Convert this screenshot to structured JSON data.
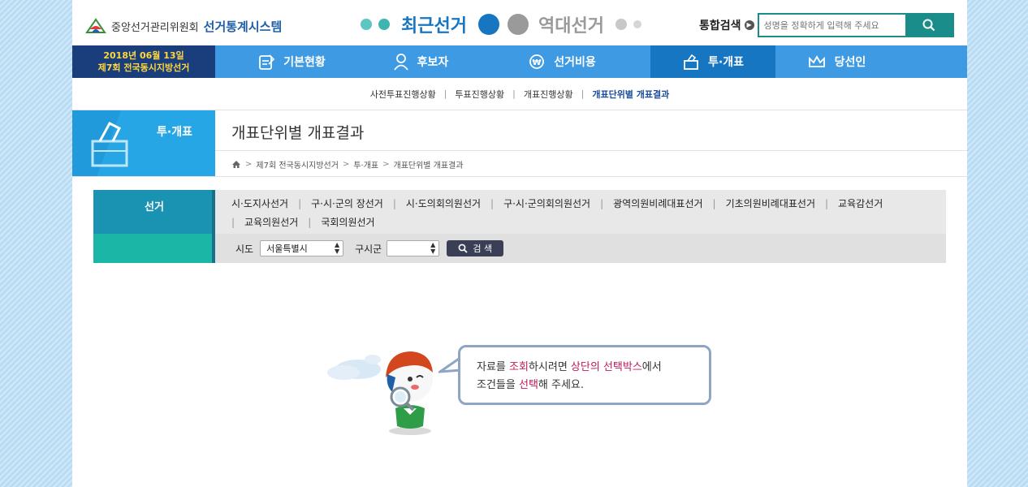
{
  "header": {
    "org_name": "중앙선거관리위원회",
    "system_name": "선거통계시스템",
    "recent_elections": "최근선거",
    "past_elections": "역대선거",
    "search_label": "통합검색",
    "search_placeholder": "성명을 정확하게 입력해 주세요"
  },
  "election_badge": {
    "date": "2018년 06월 13일",
    "name": "제7회 전국동시지방선거"
  },
  "nav": [
    {
      "label": "기본현황",
      "icon": "clipboard-icon"
    },
    {
      "label": "후보자",
      "icon": "person-icon"
    },
    {
      "label": "선거비용",
      "icon": "won-coin-icon"
    },
    {
      "label": "투·개표",
      "icon": "ballot-box-icon",
      "active": true
    },
    {
      "label": "당선인",
      "icon": "crown-icon"
    }
  ],
  "subnav": [
    "사전투표진행상황",
    "투표진행상황",
    "개표진행상황",
    "개표단위별 개표결과"
  ],
  "section": {
    "category": "투·개표",
    "title": "개표단위별 개표결과"
  },
  "breadcrumb": [
    "제7회 전국동시지방선거",
    "투·개표",
    "개표단위별 개표결과"
  ],
  "filter": {
    "label": "선거",
    "election_types": [
      "시·도지사선거",
      "구·시·군의 장선거",
      "시·도의회의원선거",
      "구·시·군의회의원선거",
      "광역의원비례대표선거",
      "기초의원비례대표선거",
      "교육감선거",
      "교육의원선거",
      "국회의원선거"
    ],
    "sido_label": "시도",
    "sido_value": "서울특별시",
    "gusigun_label": "구시군",
    "gusigun_value": "",
    "search_button": "검 색"
  },
  "message": {
    "p1": "자료를 ",
    "h1": "조회",
    "p2": "하시려면 ",
    "h2": "상단의 선택박스",
    "p3": "에서",
    "p4": "조건들을 ",
    "h3": "선택",
    "p5": "해 주세요."
  },
  "colors": {
    "nav_blue": "#3e9be3",
    "nav_active": "#1776c2",
    "badge_navy": "#1a3d7c",
    "badge_yellow": "#ffd83c",
    "search_teal": "#1a8c8a",
    "highlight": "#c2185b"
  }
}
